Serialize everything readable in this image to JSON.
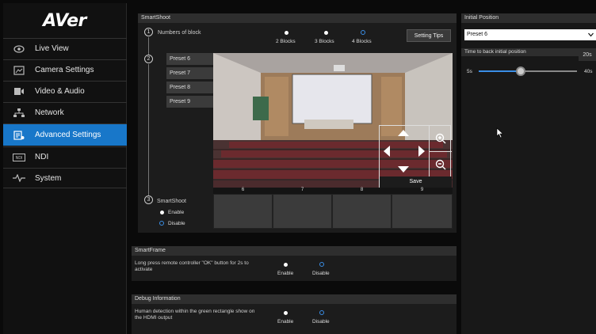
{
  "app": {
    "logo": "AVer"
  },
  "sidebar": {
    "items": [
      {
        "label": "Live View",
        "icon": "eye-icon",
        "active": false
      },
      {
        "label": "Camera Settings",
        "icon": "camera-settings-icon",
        "active": false
      },
      {
        "label": "Video & Audio",
        "icon": "video-audio-icon",
        "active": false
      },
      {
        "label": "Network",
        "icon": "network-icon",
        "active": false
      },
      {
        "label": "Advanced Settings",
        "icon": "advanced-settings-icon",
        "active": true
      },
      {
        "label": "NDI",
        "icon": "ndi-icon",
        "active": false
      },
      {
        "label": "System",
        "icon": "system-icon",
        "active": false
      }
    ]
  },
  "smartshoot": {
    "title": "SmartShoot",
    "steps": [
      "1",
      "2",
      "3"
    ],
    "numbers_label": "Numbers of block",
    "blocks": [
      {
        "label": "2 Blocks",
        "selected": false
      },
      {
        "label": "3 Blocks",
        "selected": false
      },
      {
        "label": "4 Blocks",
        "selected": true
      }
    ],
    "setting_tips": "Setting Tips",
    "presets": [
      "Preset 6",
      "Preset 7",
      "Preset 8",
      "Preset 9"
    ],
    "slots": [
      "6",
      "7",
      "8",
      "9"
    ],
    "ptz_save": "Save",
    "smartshoot_label": "SmartShoot",
    "enable": "Enable",
    "disable": "Disable",
    "state": "Disable"
  },
  "smartframe": {
    "title": "SmartFrame",
    "description": "Long press remote controller \"OK\" button for 2s to activate",
    "enable": "Enable",
    "disable": "Disable",
    "state": "Disable"
  },
  "debug": {
    "title": "Debug Information",
    "description": "Human detection within the green rectangle show on the HDMI output",
    "enable": "Enable",
    "disable": "Disable",
    "state": "Disable"
  },
  "initial_position": {
    "title": "Initial Position",
    "selected": "Preset 6",
    "time_label": "Time to back initial position",
    "value": "20s",
    "min": "5s",
    "max": "40s",
    "fraction": 0.43
  },
  "colors": {
    "accent": "#1877c9",
    "radio_selected": "#3a8ee6"
  }
}
